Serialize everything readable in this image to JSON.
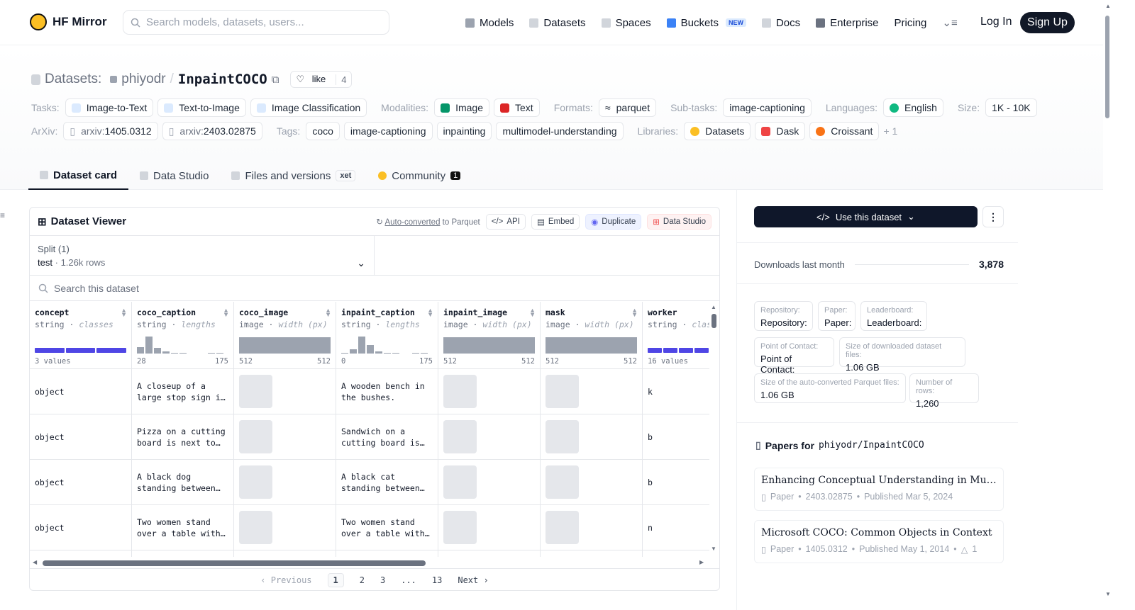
{
  "nav": {
    "brand": "HF Mirror",
    "search_placeholder": "Search models, datasets, users...",
    "links": [
      "Models",
      "Datasets",
      "Spaces",
      "Buckets",
      "Docs",
      "Enterprise",
      "Pricing"
    ],
    "new_badge": "NEW",
    "login": "Log In",
    "signup": "Sign Up"
  },
  "header": {
    "datasets_label": "Datasets:",
    "owner": "phiyodr",
    "repo": "InpaintCOCO",
    "like_label": "like",
    "like_count": "4",
    "row1": {
      "tasks_label": "Tasks:",
      "tasks": [
        "Image-to-Text",
        "Text-to-Image",
        "Image Classification"
      ],
      "modalities_label": "Modalities:",
      "modalities": [
        "Image",
        "Text"
      ],
      "formats_label": "Formats:",
      "formats": [
        "parquet"
      ],
      "subtasks_label": "Sub-tasks:",
      "subtasks": [
        "image-captioning"
      ],
      "languages_label": "Languages:",
      "languages": [
        "English"
      ],
      "size_label": "Size:",
      "size": "1K - 10K"
    },
    "row2": {
      "arxiv_label": "ArXiv:",
      "arxiv": [
        {
          "prefix": "arxiv:",
          "id": "1405.0312"
        },
        {
          "prefix": "arxiv:",
          "id": "2403.02875"
        }
      ],
      "tags_label": "Tags:",
      "tags": [
        "coco",
        "image-captioning",
        "inpainting",
        "multimodel-understanding"
      ],
      "libraries_label": "Libraries:",
      "libraries": [
        "Datasets",
        "Dask",
        "Croissant"
      ],
      "more": "+ 1"
    }
  },
  "tabs": [
    {
      "label": "Dataset card",
      "active": true
    },
    {
      "label": "Data Studio"
    },
    {
      "label": "Files and versions",
      "badge": "xet"
    },
    {
      "label": "Community",
      "badge": "1"
    }
  ],
  "viewer": {
    "title": "Dataset Viewer",
    "auto_converted": "Auto-converted",
    "to_parquet": "to Parquet",
    "actions": [
      "API",
      "Embed",
      "Duplicate",
      "Data Studio"
    ],
    "split_label": "Split (1)",
    "split_name": "test",
    "split_rows": "1.26k rows",
    "search_placeholder": "Search this dataset",
    "columns": [
      {
        "name": "concept",
        "type": "string",
        "stat": "classes",
        "kind": "classes",
        "lo": "3 values",
        "hi": ""
      },
      {
        "name": "coco_caption",
        "type": "string",
        "stat": "lengths",
        "kind": "hist",
        "lo": "28",
        "hi": "175"
      },
      {
        "name": "coco_image",
        "type": "image",
        "stat": "width (px)",
        "kind": "image",
        "lo": "512",
        "hi": "512"
      },
      {
        "name": "inpaint_caption",
        "type": "string",
        "stat": "lengths",
        "kind": "hist",
        "lo": "0",
        "hi": "175"
      },
      {
        "name": "inpaint_image",
        "type": "image",
        "stat": "width (px)",
        "kind": "image",
        "lo": "512",
        "hi": "512"
      },
      {
        "name": "mask",
        "type": "image",
        "stat": "width (px)",
        "kind": "image",
        "lo": "512",
        "hi": "512"
      },
      {
        "name": "worker",
        "type": "string",
        "stat": "clas",
        "kind": "classes",
        "lo": "16 values",
        "hi": ""
      }
    ],
    "rows": [
      {
        "concept": "object",
        "coco_caption": "A closeup of a large stop sign i…",
        "inpaint_caption": "A wooden bench in the bushes.",
        "worker": "k"
      },
      {
        "concept": "object",
        "coco_caption": "Pizza on a cutting board is next to…",
        "inpaint_caption": "Sandwich on a cutting board is…",
        "worker": "b"
      },
      {
        "concept": "object",
        "coco_caption": "A black dog standing between…",
        "inpaint_caption": "A black cat standing between…",
        "worker": "b"
      },
      {
        "concept": "object",
        "coco_caption": "Two women stand over a table with…",
        "inpaint_caption": "Two women stand over a table with…",
        "worker": "n"
      }
    ],
    "pager": {
      "prev": "Previous",
      "pages": [
        "1",
        "2",
        "3",
        "...",
        "13"
      ],
      "next": "Next"
    }
  },
  "sidebar": {
    "use_button": "Use this dataset",
    "downloads_label": "Downloads last month",
    "downloads": "3,878",
    "meta": [
      {
        "k": "Repository:",
        "v": "Repository:"
      },
      {
        "k": "Paper:",
        "v": "Paper:"
      },
      {
        "k": "Leaderboard:",
        "v": "Leaderboard:"
      },
      {
        "k": "Point of Contact:",
        "v": "Point of Contact:"
      },
      {
        "k": "Size of downloaded dataset files:",
        "v": "1.06 GB"
      },
      {
        "k": "Size of the auto-converted Parquet files:",
        "v": "1.06 GB"
      },
      {
        "k": "Number of rows:",
        "v": "1,260"
      }
    ],
    "papers_label": "Papers for",
    "papers_repo": "phiyodr/InpaintCOCO",
    "papers": [
      {
        "title": "Enhancing Conceptual Understanding in Multimo…",
        "type": "Paper",
        "id": "2403.02875",
        "published": "Published Mar 5, 2024",
        "upvotes": ""
      },
      {
        "title": "Microsoft COCO: Common Objects in Context",
        "type": "Paper",
        "id": "1405.0312",
        "published": "Published May 1, 2014",
        "upvotes": "1"
      }
    ]
  }
}
